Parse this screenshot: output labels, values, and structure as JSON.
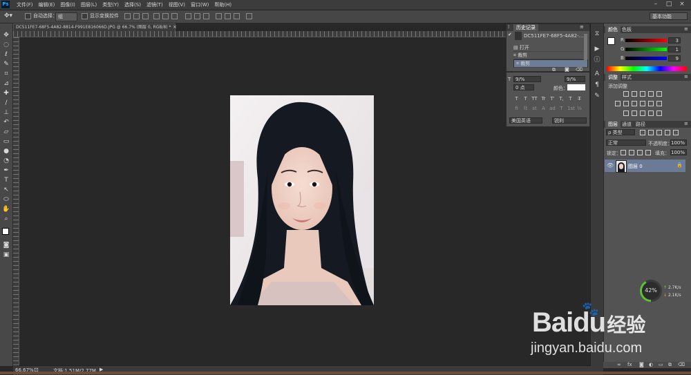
{
  "app": {
    "logo": "Ps",
    "menu": [
      "文件(F)",
      "编辑(E)",
      "图像(I)",
      "图层(L)",
      "类型(Y)",
      "选择(S)",
      "滤镜(T)",
      "视图(V)",
      "窗口(W)",
      "帮助(H)"
    ],
    "window_controls": [
      "–",
      "□",
      "×"
    ]
  },
  "options_bar": {
    "auto_select_label": "自动选择：",
    "auto_select_value": "组",
    "show_transform_label": "显示变换控件",
    "workspace": "基本功能"
  },
  "document": {
    "tab_title": "DC511FE7-68F5-4A82-8814-F991E816066D.JPG @ 66.7% (图层 0, RGB/8) *",
    "close": "×"
  },
  "status_bar": {
    "zoom": "66.67%",
    "doc_info": "文档:1.51M/2.77M"
  },
  "history_panel": {
    "tabs": [
      "历史记录"
    ],
    "snapshot_name": "DC511FE7-68F5-4A82-...",
    "items": [
      {
        "label": "打开",
        "icon": "open-icon"
      },
      {
        "label": "裁剪",
        "icon": "crop-icon"
      },
      {
        "label": "裁剪",
        "icon": "crop-icon"
      }
    ]
  },
  "character_panel": {
    "size_value": "9/%",
    "tracking_value": "0 点",
    "color_label": "颜色：",
    "language": "美国英语",
    "antialias": "锐利",
    "glyph_row1": [
      "T",
      "T",
      "TT",
      "Tr",
      "T'",
      "T,",
      "T",
      "T̶"
    ],
    "glyph_row2": [
      "fi",
      "ſt",
      "st",
      "A",
      "ad",
      "T",
      "1st",
      "½"
    ]
  },
  "color_panel": {
    "tabs": [
      "颜色",
      "色板"
    ],
    "channels": [
      {
        "label": "R",
        "value": "3"
      },
      {
        "label": "G",
        "value": "1"
      },
      {
        "label": "B",
        "value": "9"
      }
    ]
  },
  "adjustments_panel": {
    "tabs": [
      "调整",
      "样式"
    ],
    "title": "添加调整"
  },
  "layers_panel": {
    "tabs": [
      "图层",
      "通道",
      "路径"
    ],
    "filter_kind": "ρ 类型",
    "blend_mode": "正常",
    "opacity_label": "不透明度：",
    "opacity_value": "100%",
    "lock_label": "锁定：",
    "fill_label": "填充：",
    "fill_value": "100%",
    "layers": [
      {
        "name": "图层 0",
        "visible": true
      }
    ]
  },
  "speed_widget": {
    "percent": "42%",
    "upload": "2.7K/s",
    "download": "2.1K/s"
  },
  "watermark": {
    "brand": "Baidu",
    "brand_cn": "经验",
    "url": "jingyan.baidu.com"
  }
}
